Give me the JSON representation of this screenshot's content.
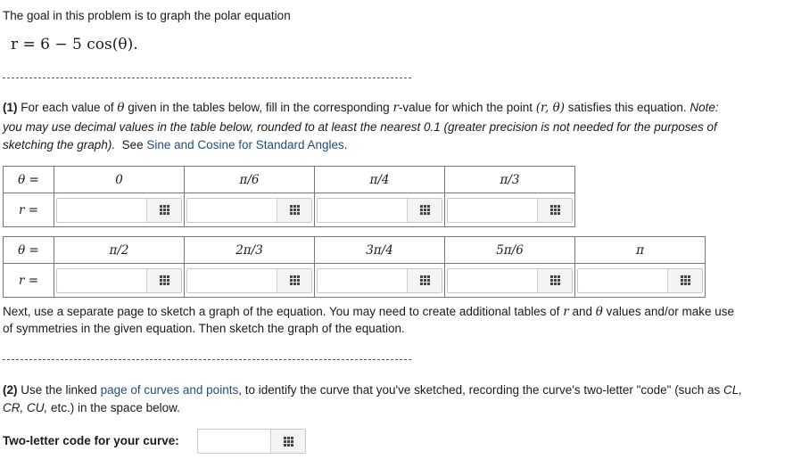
{
  "intro": {
    "text": "The goal in this problem is to graph the polar equation",
    "equation": "r = 6 − 5 cos(θ)."
  },
  "part1": {
    "label": "(1)",
    "text_a": "For each value of",
    "theta": "θ",
    "text_b": "given in the tables below, fill in the corresponding",
    "r": "r",
    "text_c": "-value for which the point",
    "point": "(r, θ)",
    "text_d": "satisfies this equation.",
    "note": "Note:",
    "note_line2": "you may use decimal values in the table below, rounded to at least the nearest 0.1 (greater precision is not needed for the purposes of",
    "note_line3": "sketching the graph).",
    "see": "See",
    "link": "Sine and Cosine for Standard Angles",
    "link_end": "."
  },
  "table1": {
    "theta_header": "θ =",
    "r_header": "r =",
    "angles": [
      "0",
      "π/6",
      "π/4",
      "π/3"
    ]
  },
  "table2": {
    "theta_header": "θ =",
    "r_header": "r =",
    "angles": [
      "π/2",
      "2π/3",
      "3π/4",
      "5π/6",
      "π"
    ]
  },
  "next": {
    "line1_a": "Next, use a separate page to sketch a graph of the equation. You may need to create additional tables of",
    "line1_r": "r",
    "line1_and": "and",
    "line1_theta": "θ",
    "line1_b": "values and/or make use",
    "line2": "of symmetries in the given equation. Then sketch the graph of the equation."
  },
  "part2": {
    "label": "(2)",
    "text_a": "Use the linked",
    "link": "page of curves and points",
    "text_b": ", to identify the curve that you've sketched, recording the curve's two-letter \"code\" (such as",
    "cl": "CL,",
    "cr_cu": "CR, CU,",
    "text_c": "etc.) in the space below."
  },
  "code": {
    "label": "Two-letter code for your curve:"
  }
}
